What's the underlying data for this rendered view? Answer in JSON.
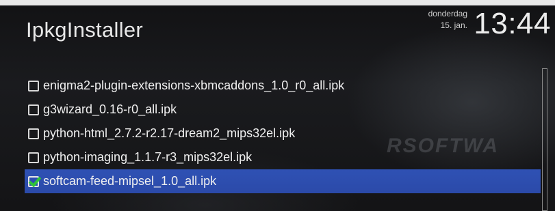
{
  "header": {
    "title": "IpkgInstaller",
    "day": "donderdag",
    "date": "15. jan.",
    "time": "13:44"
  },
  "watermark": "RSOFTWA",
  "packages": [
    {
      "label": "enigma2-plugin-extensions-xbmcaddons_1.0_r0_all.ipk",
      "checked": false,
      "selected": false
    },
    {
      "label": "g3wizard_0.16-r0_all.ipk",
      "checked": false,
      "selected": false
    },
    {
      "label": "python-html_2.7.2-r2.17-dream2_mips32el.ipk",
      "checked": false,
      "selected": false
    },
    {
      "label": "python-imaging_1.1.7-r3_mips32el.ipk",
      "checked": false,
      "selected": false
    },
    {
      "label": "softcam-feed-mipsel_1.0_all.ipk",
      "checked": true,
      "selected": true
    }
  ],
  "colors": {
    "selection": "#2f51b4",
    "check": "#2ec23a",
    "text": "#f0f0f0"
  }
}
